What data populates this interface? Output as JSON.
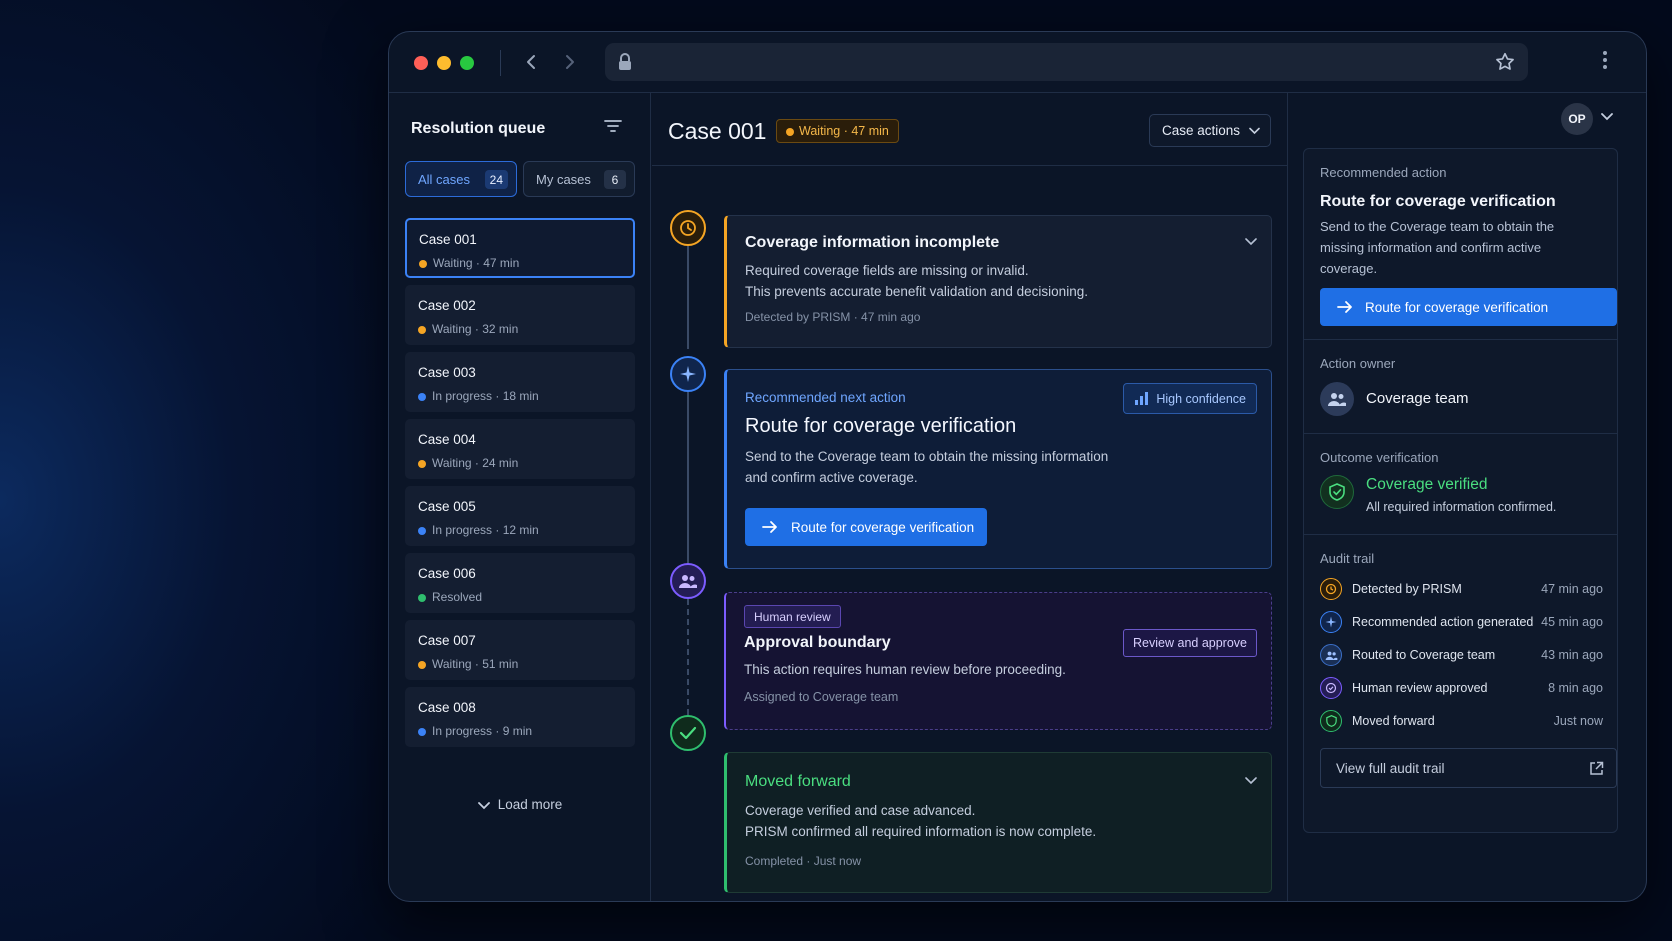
{
  "sidebar": {
    "title": "Resolution queue",
    "tabs": [
      {
        "label": "All cases",
        "count": "24"
      },
      {
        "label": "My cases",
        "count": "6"
      }
    ],
    "cases": [
      {
        "name": "Case 001",
        "status": "Waiting · 47 min",
        "color": "#f5a524"
      },
      {
        "name": "Case 002",
        "status": "Waiting · 32 min",
        "color": "#f5a524"
      },
      {
        "name": "Case 003",
        "status": "In progress · 18 min",
        "color": "#3b82f6"
      },
      {
        "name": "Case 004",
        "status": "Waiting · 24 min",
        "color": "#f5a524"
      },
      {
        "name": "Case 005",
        "status": "In progress · 12 min",
        "color": "#3b82f6"
      },
      {
        "name": "Case 006",
        "status": "Resolved",
        "color": "#2fbe6e"
      },
      {
        "name": "Case 007",
        "status": "Waiting · 51 min",
        "color": "#f5a524"
      },
      {
        "name": "Case 008",
        "status": "In progress · 9 min",
        "color": "#3b82f6"
      }
    ],
    "load_more": "Load more"
  },
  "main": {
    "title": "Case 001",
    "status": "Waiting · 47 min",
    "actions_label": "Case actions",
    "card1": {
      "title": "Coverage information incomplete",
      "line1": "Required coverage fields are missing or invalid.",
      "line2": "This prevents accurate benefit validation and decisioning.",
      "meta": "Detected by PRISM · 47 min ago"
    },
    "card2": {
      "label": "Recommended next action",
      "title": "Route for coverage verification",
      "badge": "High confidence",
      "line1": "Send to the Coverage team to obtain the missing information",
      "line2": "and confirm active coverage.",
      "button": "Route for coverage verification"
    },
    "card3": {
      "badge": "Human review",
      "title": "Approval boundary",
      "line1": "This action requires human review before proceeding.",
      "meta": "Assigned to Coverage team",
      "button": "Review and approve"
    },
    "card4": {
      "title": "Moved forward",
      "line1": "Coverage verified and case advanced.",
      "line2": "PRISM confirmed all required information is now complete.",
      "meta": "Completed · Just now"
    }
  },
  "right": {
    "avatar": "OP",
    "recommended": {
      "label": "Recommended action",
      "title": "Route for coverage verification",
      "body": "Send to the Coverage team to obtain the missing information and confirm active coverage.",
      "button": "Route for coverage verification"
    },
    "owner": {
      "label": "Action owner",
      "name": "Coverage team"
    },
    "outcome": {
      "label": "Outcome verification",
      "title": "Coverage verified",
      "sub": "All required information confirmed."
    },
    "audit": {
      "label": "Audit trail",
      "rows": [
        {
          "text": "Detected by PRISM",
          "time": "47 min ago"
        },
        {
          "text": "Recommended action generated",
          "time": "45 min ago"
        },
        {
          "text": "Routed to Coverage team",
          "time": "43 min ago"
        },
        {
          "text": "Human review approved",
          "time": "8 min ago"
        },
        {
          "text": "Moved forward",
          "time": "Just now"
        }
      ],
      "view_all": "View full audit trail"
    }
  },
  "colors": {
    "accent": "#1f6fe5",
    "waiting": "#f5a524",
    "progress": "#3b82f6",
    "resolved": "#2fbe6e",
    "review": "#7c5cff"
  }
}
